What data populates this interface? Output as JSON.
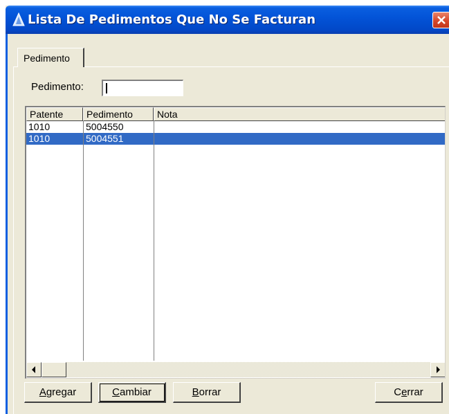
{
  "window": {
    "title": "Lista De Pedimentos Que No Se Facturan"
  },
  "tabs": [
    {
      "label": "Pedimento"
    }
  ],
  "form": {
    "pedimento_label": "Pedimento:",
    "pedimento_value": ""
  },
  "grid": {
    "columns": [
      "Patente",
      "Pedimento",
      "Nota"
    ],
    "rows": [
      {
        "patente": "1010",
        "pedimento": "5004550",
        "nota": ""
      },
      {
        "patente": "1010",
        "pedimento": "5004551",
        "nota": ""
      }
    ],
    "selected_row": 1
  },
  "buttons": {
    "agregar": {
      "mnemonic": "A",
      "rest": "gregar"
    },
    "cambiar": {
      "mnemonic": "C",
      "rest": "ambiar"
    },
    "borrar": {
      "mnemonic": "B",
      "rest": "orrar"
    },
    "cerrar": {
      "pre": "C",
      "mnemonic": "e",
      "rest": "rrar"
    }
  },
  "colors": {
    "title_bar": "#0354d8",
    "selection": "#316ac5",
    "close_button": "#d6472b"
  },
  "icons": {
    "app": "app-icon",
    "close": "close-icon",
    "scroll_left": "arrow-left-icon",
    "scroll_right": "arrow-right-icon"
  }
}
